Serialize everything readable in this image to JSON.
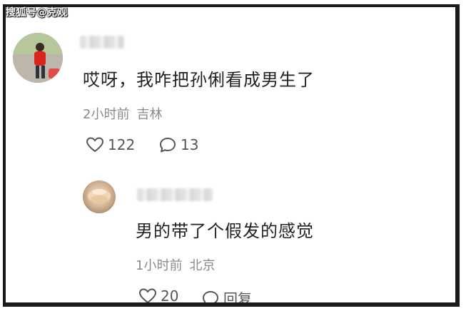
{
  "watermark": "搜狐号@克观",
  "comment": {
    "avatar_icon": "user-avatar",
    "username_blurred": true,
    "text": "哎呀，我咋把孙俐看成男生了",
    "time": "2小时前",
    "location": "吉林",
    "likes": "122",
    "replies": "13"
  },
  "reply": {
    "avatar_icon": "user-avatar",
    "username_blurred": true,
    "text": "男的带了个假发的感觉",
    "time": "1小时前",
    "location": "北京",
    "likes": "20",
    "reply_label": "回复"
  },
  "colors": {
    "text": "#222222",
    "meta": "#8a8a8a",
    "icon": "#555555",
    "frame": "#1a1a1a"
  }
}
